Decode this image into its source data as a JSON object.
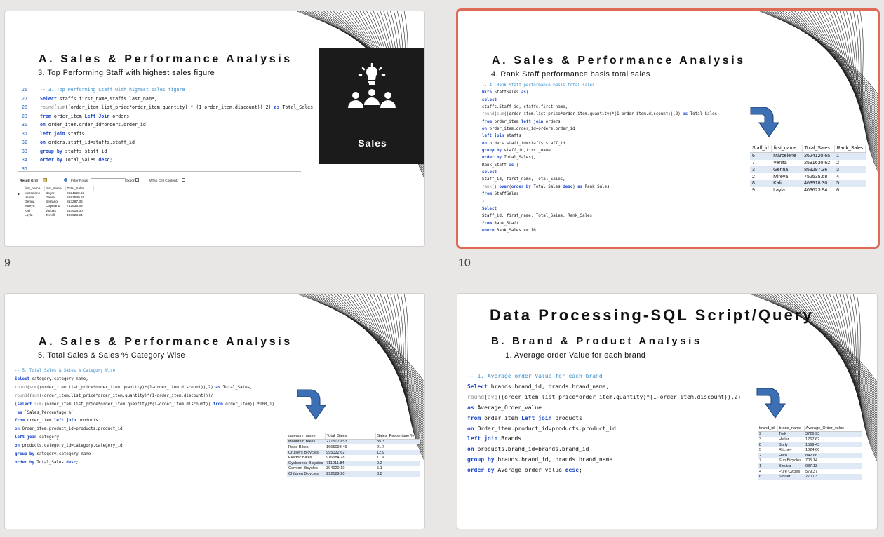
{
  "slides": [
    {
      "number": "9",
      "title": "A. Sales & Performance Analysis",
      "subtitle": "3. Top Performing Staff with highest sales figure",
      "tile_label": "Sales",
      "tile_icon": "team-idea-icon",
      "line_numbers": [
        "26",
        "27",
        "28",
        "29",
        "30",
        "31",
        "32",
        "33",
        "34",
        "35"
      ],
      "code": [
        "-- 3. Top Performing Staff with highest sales figure",
        "Select staffs.first_name,staffs.last_name,",
        "round(sum((order_item.list_price*order_item.quantity) * (1-order_item.discount)),2) as Total_Sales",
        "from order_item Left Join orders",
        "on order_item.order_id=orders.order_id",
        "left join staffs",
        "on orders.staff_id=staffs.staff_id",
        "group by staffs.staff_id",
        "order by Total_Sales desc;",
        ""
      ],
      "grid_toolbar": {
        "result_grid": "Result Grid",
        "filter_rows": "Filter Rows:",
        "export": "Export:",
        "wrap": "Wrap Cell Content:"
      },
      "table": {
        "columns": [
          "first_name",
          "last_name",
          "Total_Sales"
        ],
        "rows": [
          [
            "Marcelene",
            "Boyer",
            "2624120.65"
          ],
          [
            "Venita",
            "Daniel",
            "2591630.62"
          ],
          [
            "Genna",
            "Serrano",
            "853287.36"
          ],
          [
            "Mireya",
            "Copeland",
            "752535.68"
          ],
          [
            "Kali",
            "Vargas",
            "463918.30"
          ],
          [
            "Layla",
            "Terrell",
            "403623.94"
          ]
        ]
      }
    },
    {
      "number": "10",
      "title": "A. Sales & Performance Analysis",
      "subtitle": "4. Rank Staff performance basis total sales",
      "code": [
        "-- 4. Rank Staff performance basis total sales",
        "With StaffSales as(",
        "select",
        "staffs.Staff_id, staffs.first_name,",
        "round(sum((order_item.list_price*order_item.quantity)*(1-order_item.discount)),2) as Total_Sales",
        "from order_item left join orders",
        "on order_item.order_id=orders.order_id",
        "left join staffs",
        "on orders.staff_id=staffs.staff_id",
        "group by staff_id,first_name",
        "order by Total_Sales),",
        "Rank_Staff as (",
        "select",
        "Staff_id, first_name, Total_Sales,",
        "rank() over(order by Total_Sales desc) as Rank_Sales",
        "from StaffSales",
        ")",
        "Select",
        "Staff_id, first_name, Total_Sales, Rank_Sales",
        "from Rank_Staff",
        "where Rank_Sales <= 10;"
      ],
      "table": {
        "columns": [
          "Staff_id",
          "first_name",
          "Total_Sales",
          "Rank_Sales"
        ],
        "rows": [
          [
            "6",
            "Marcelene",
            "2624120.65",
            "1"
          ],
          [
            "7",
            "Venita",
            "2591630.62",
            "2"
          ],
          [
            "3",
            "Genna",
            "853287.36",
            "3"
          ],
          [
            "2",
            "Mireya",
            "752535.68",
            "4"
          ],
          [
            "8",
            "Kali",
            "463918.30",
            "5"
          ],
          [
            "9",
            "Layla",
            "403623.94",
            "6"
          ]
        ]
      }
    },
    {
      "title": "A. Sales & Performance Analysis",
      "subtitle": "5. Total Sales & Sales % Category Wise",
      "code": [
        "-- 5. Total Sales & Sales % Category Wise",
        "Select category.category_name,",
        "round(sum((order_item.list_price*order_item.quantity)*(1-order_item.discount)),2) as Total_Sales,",
        "round((sum((order_item.list_price*order_item.quantity)*(1-order_item.discount)))/",
        "(select sum((order_item.list_price*order_item.quantity)*(1-order_item.discount)) from order_item)) *100,1)",
        " as `Sales_Percentage %`",
        "from order_item left join products",
        "on Order_item.product_id=products.product_id",
        "left join category",
        "on products.category_id=category.category_id",
        "group by category.category_name",
        "order by Total_Sales desc;"
      ],
      "table": {
        "columns": [
          "category_name",
          "Total_Sales",
          "Sales_Percentage %"
        ],
        "rows": [
          [
            "Mountain Bikes",
            "2715079.53",
            "35.3"
          ],
          [
            "Road Bikes",
            "1665098.49",
            "21.7"
          ],
          [
            "Cruisers Bicycles",
            "995032.62",
            "12.9"
          ],
          [
            "Electric Bikes",
            "916684.78",
            "11.9"
          ],
          [
            "Cyclocross Bicycles",
            "711011.84",
            "9.2"
          ],
          [
            "Comfort Bicycles",
            "394020.10",
            "5.1"
          ],
          [
            "Children Bicycles",
            "292189.20",
            "3.8"
          ]
        ]
      }
    },
    {
      "heading": "Data Processing-SQL Script/Query",
      "title": "B. Brand & Product Analysis",
      "subtitle": "1. Average order Value for each brand",
      "code": [
        "-- 1. Average order Value for each brand",
        "Select brands.brand_id, brands.brand_name,",
        "round(avg((order_item.list_price*order_item.quantity)*(1-order_item.discount)),2)",
        "as Average_Order_value",
        "from order_item Left join products",
        "on Order_item.product_id=products.product_id",
        "left join Brands",
        "on products.brand_id=brands.brand_id",
        "group by brands.brand_id, brands.brand_name",
        "order by Average_order_value desc;"
      ],
      "table": {
        "columns": [
          "brand_id",
          "brand_name",
          "Average_Order_value"
        ],
        "rows": [
          [
            "9",
            "Trek",
            "3726.93"
          ],
          [
            "3",
            "Heller",
            "1767.62"
          ],
          [
            "8",
            "Surly",
            "1569.43"
          ],
          [
            "5",
            "Ritchey",
            "1024.66"
          ],
          [
            "2",
            "Haro",
            "842.66"
          ],
          [
            "7",
            "Sun Bicycles",
            "705.14"
          ],
          [
            "1",
            "Electra",
            "697.12"
          ],
          [
            "4",
            "Pure Cycles",
            "579.37"
          ],
          [
            "6",
            "Strider",
            "270.03"
          ]
        ]
      }
    }
  ],
  "colors": {
    "selection_border": "#e06a58",
    "sql_keyword": "#1a46c8",
    "comment": "#3a8fcc",
    "tile_bg": "#1b1b1b",
    "arrow": "#3c6fb3"
  }
}
